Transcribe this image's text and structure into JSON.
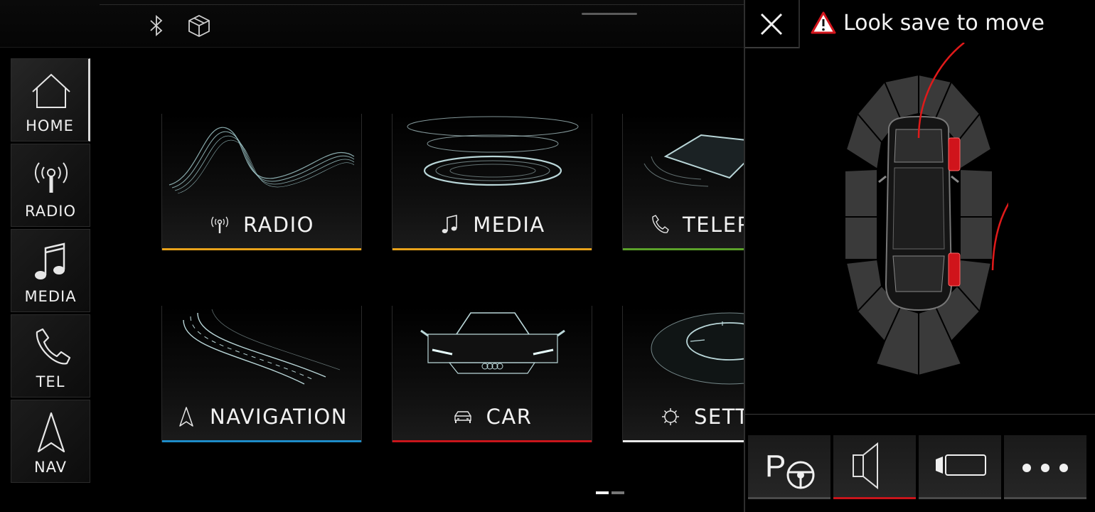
{
  "topbar": {
    "icons": [
      "bluetooth-icon",
      "package-box-icon"
    ]
  },
  "sidebar": {
    "items": [
      {
        "label": "HOME",
        "icon": "home-icon",
        "active": true
      },
      {
        "label": "RADIO",
        "icon": "radio-antenna-icon"
      },
      {
        "label": "MEDIA",
        "icon": "music-note-icon"
      },
      {
        "label": "TEL",
        "icon": "phone-icon"
      },
      {
        "label": "NAV",
        "icon": "navigation-arrow-icon"
      }
    ]
  },
  "tiles": [
    {
      "label": "RADIO",
      "icon": "radio-antenna-icon",
      "accent": "#e8a21a"
    },
    {
      "label": "MEDIA",
      "icon": "music-note-icon",
      "accent": "#e8a21a"
    },
    {
      "label": "TELEP",
      "icon": "phone-icon",
      "accent": "#5aa12a"
    },
    {
      "label": "NAVIGATION",
      "icon": "navigation-arrow-icon",
      "accent": "#1e8cc8"
    },
    {
      "label": "CAR",
      "icon": "car-icon",
      "accent": "#c8151b"
    },
    {
      "label": "SETT",
      "icon": "gear-icon",
      "accent": "#e8e8e8"
    }
  ],
  "pagination": {
    "pages": 2,
    "current": 1
  },
  "parking": {
    "warning_text": "Look save to move",
    "warning_icon": "warning-triangle-icon",
    "close_icon": "close-icon",
    "buttons": [
      {
        "name": "park-assist-button",
        "icon": "park-steering-icon"
      },
      {
        "name": "sound-toggle-button",
        "icon": "speaker-icon",
        "active": true
      },
      {
        "name": "camera-view-button",
        "icon": "camera-view-icon"
      },
      {
        "name": "more-options-button",
        "icon": "more-dots-icon"
      }
    ],
    "accent_red": "#c8151b"
  }
}
